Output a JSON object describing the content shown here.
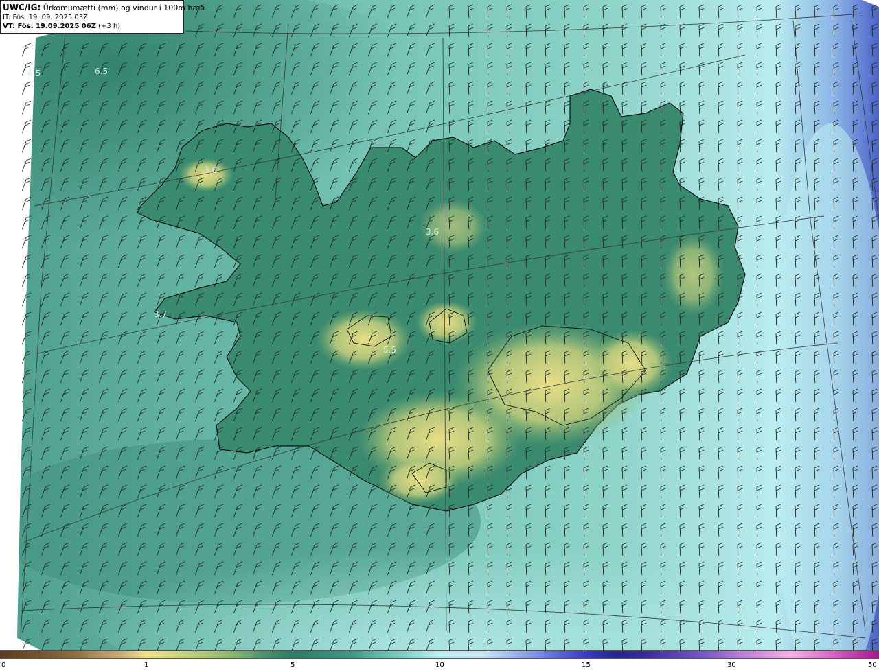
{
  "header": {
    "product_code": "UWC/IG:",
    "description": "Úrkomumætti (mm) og vindur í 100m hæð",
    "init_time": "IT: Fös. 19. 09. 2025 03Z",
    "valid_prefix": "VT: Fös. 19.09.2025 06Z",
    "valid_offset": "(+3 h)"
  },
  "map_labels": [
    "6.5",
    "6.5",
    "3.6",
    "3.6",
    "3.7",
    "5.5"
  ],
  "colorbar": {
    "ticks": [
      "0",
      "1",
      "5",
      "10",
      "15",
      "30",
      "50"
    ]
  },
  "colors": {
    "land_low": "#e3dc85",
    "land_mid": "#2f7d63",
    "sea_light": "#a9e2da",
    "sea_mid": "#7cc9bd",
    "deep_blue": "#4a66c9",
    "coast": "#111111",
    "grid": "#333333"
  },
  "icons": {
    "wind": "wind-barb-icon"
  }
}
